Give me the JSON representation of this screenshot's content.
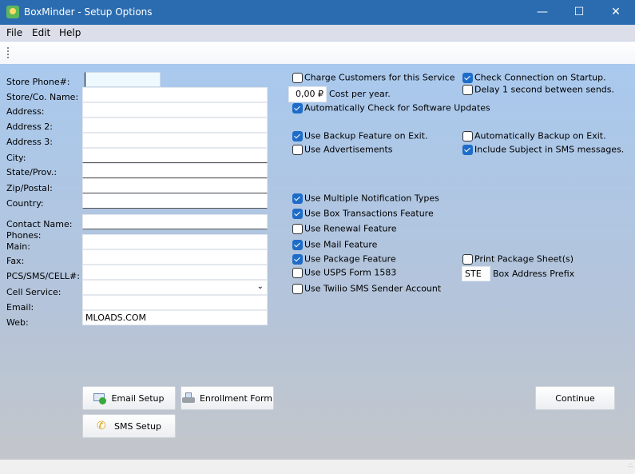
{
  "window": {
    "title": "BoxMinder - Setup Options"
  },
  "menu": [
    "File",
    "Edit",
    "Help"
  ],
  "fields": {
    "store_phone": {
      "label": "Store Phone#:",
      "value": ""
    },
    "store_name": {
      "label": "Store/Co. Name:",
      "value": ""
    },
    "address": {
      "label": "Address:",
      "value": ""
    },
    "address2": {
      "label": "Address 2:",
      "value": ""
    },
    "address3": {
      "label": "Address 3:",
      "value": ""
    },
    "city": {
      "label": "City:",
      "value": ""
    },
    "state": {
      "label": "State/Prov.:",
      "value": ""
    },
    "zip": {
      "label": "Zip/Postal:",
      "value": ""
    },
    "country": {
      "label": "Country:",
      "value": ""
    },
    "contact": {
      "label": "Contact Name:",
      "value": ""
    },
    "phones_label": "Phones:",
    "main": {
      "label": "Main:",
      "value": ""
    },
    "fax": {
      "label": "Fax:",
      "value": ""
    },
    "pcs": {
      "label": "PCS/SMS/CELL#:",
      "value": ""
    },
    "cell_service": {
      "label": "Cell Service:",
      "value": ""
    },
    "email": {
      "label": "Email:",
      "value": ""
    },
    "web": {
      "label": "Web:",
      "value": "MLOADS.COM"
    }
  },
  "options": {
    "charge": {
      "label": "Charge Customers for this Service",
      "checked": false
    },
    "cost": {
      "value": "0,00 ₽",
      "label": "Cost per year."
    },
    "auto_update": {
      "label": "Automatically Check for Software Updates",
      "checked": true
    },
    "check_conn": {
      "label": "Check Connection on Startup.",
      "checked": true
    },
    "delay": {
      "label": "Delay 1 second between sends.",
      "checked": false
    },
    "backup_exit": {
      "label": "Use Backup Feature on Exit.",
      "checked": true
    },
    "ads": {
      "label": "Use Advertisements",
      "checked": false
    },
    "auto_backup": {
      "label": "Automatically Backup on Exit.",
      "checked": false
    },
    "subject_sms": {
      "label": "Include Subject in SMS messages.",
      "checked": true
    },
    "multi_notif": {
      "label": "Use Multiple Notification Types",
      "checked": true
    },
    "box_trans": {
      "label": "Use Box Transactions Feature",
      "checked": true
    },
    "renewal": {
      "label": "Use Renewal Feature",
      "checked": false
    },
    "mail": {
      "label": "Use Mail Feature",
      "checked": true
    },
    "package": {
      "label": "Use Package Feature",
      "checked": true
    },
    "usps": {
      "label": "Use USPS Form 1583",
      "checked": false
    },
    "twilio": {
      "label": "Use Twilio SMS Sender Account",
      "checked": false
    },
    "print_pkg": {
      "label": "Print Package Sheet(s)",
      "checked": false
    },
    "prefix": {
      "value": "STE",
      "label": "Box Address Prefix"
    }
  },
  "buttons": {
    "email_setup": "Email Setup",
    "enrollment": "Enrollment Form",
    "sms_setup": "SMS Setup",
    "continue": "Continue"
  },
  "colors": {
    "titlebar": "#2b6cb0",
    "accent": "#1e6cc8"
  }
}
